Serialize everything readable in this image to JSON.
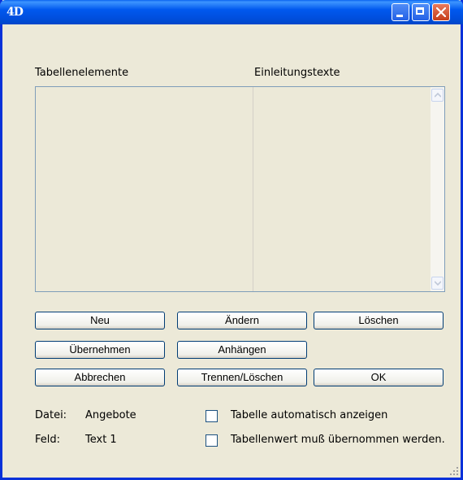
{
  "window": {
    "icon_text": "4D"
  },
  "labels": {
    "left_column": "Tabellenelemente",
    "right_column": "Einleitungstexte"
  },
  "buttons": {
    "neu": "Neu",
    "aendern": "Ändern",
    "loeschen": "Löschen",
    "uebernehmen": "Übernehmen",
    "anhaengen": "Anhängen",
    "abbrechen": "Abbrechen",
    "trennen_loeschen": "Trennen/Löschen",
    "ok": "OK"
  },
  "info": {
    "datei_label": "Datei:",
    "datei_value": "Angebote",
    "feld_label": "Feld:",
    "feld_value": "Text 1"
  },
  "options": {
    "auto_show_label": "Tabelle automatisch anzeigen",
    "auto_show_checked": false,
    "must_accept_label": "Tabellenwert muß übernommen werden.",
    "must_accept_checked": false
  },
  "colors": {
    "titlebar": "#0058ee",
    "window_bg": "#ece9d8",
    "close_button": "#c53d1a"
  },
  "icons": {
    "minimize": "minimize-icon",
    "maximize": "maximize-icon",
    "close": "close-icon"
  }
}
